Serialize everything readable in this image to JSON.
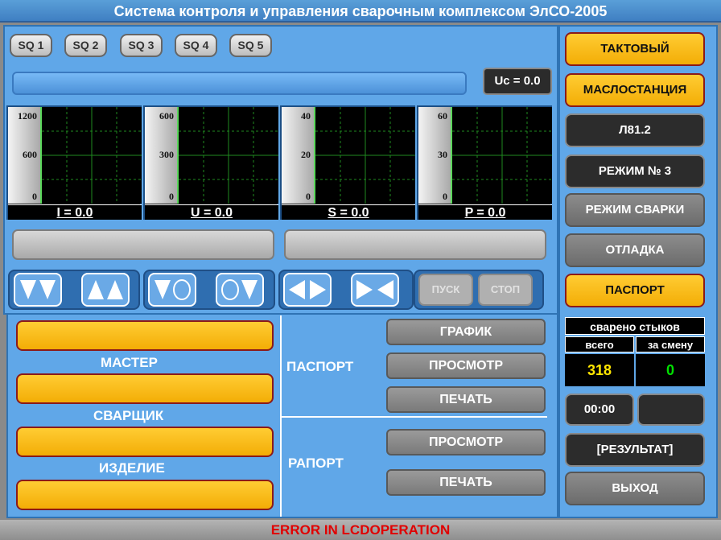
{
  "title": "Система контроля и управления сварочным комплексом ЭлСО-2005",
  "sq_buttons": [
    "SQ 1",
    "SQ 2",
    "SQ 3",
    "SQ 4",
    "SQ 5"
  ],
  "uc_display": "Uc = 0.0",
  "progress_fraction": 0,
  "charts": [
    {
      "ticks": [
        "1200",
        "600",
        "0"
      ],
      "readout": "I = 0.0"
    },
    {
      "ticks": [
        "600",
        "300",
        "0"
      ],
      "readout": "U = 0.0"
    },
    {
      "ticks": [
        "40",
        "20",
        "0"
      ],
      "readout": "S = 0.0"
    },
    {
      "ticks": [
        "60",
        "30",
        "0"
      ],
      "readout": "P = 0.0"
    }
  ],
  "controls": {
    "start_label": "ПУСК",
    "stop_label": "СТОП"
  },
  "form": {
    "master_label": "МАСТЕР",
    "welder_label": "СВАРЩИК",
    "product_label": "ИЗДЕЛИЕ",
    "passport_label": "ПАСПОРТ",
    "passport_buttons": [
      "ГРАФИК",
      "ПРОСМОТР",
      "ПЕЧАТЬ"
    ],
    "report_label": "РАПОРТ",
    "report_buttons": [
      "ПРОСМОТР",
      "ПЕЧАТЬ"
    ]
  },
  "sidebar": {
    "mode_tact": "ТАКТОВЫЙ",
    "oil_station": "МАСЛОСТАНЦИЯ",
    "program": "Л81.2",
    "mode_no": "РЕЖИМ № 3",
    "welding_mode": "РЕЖИМ СВАРКИ",
    "debug": "ОТЛАДКА",
    "passport": "ПАСПОРТ",
    "counter_title": "сварено стыков",
    "total_label": "всего",
    "shift_label": "за смену",
    "total_value": "318",
    "shift_value": "0",
    "time": "00:00",
    "result": "[РЕЗУЛЬТАТ]",
    "exit": "ВЫХОД"
  },
  "status": "ERROR IN LCDOPERATION",
  "colors": {
    "accent_yellow": "#f3ad06",
    "panel_blue": "#60a7e8",
    "error_red": "#e00000",
    "total_yellow": "#ffe600",
    "shift_green": "#00e000"
  }
}
